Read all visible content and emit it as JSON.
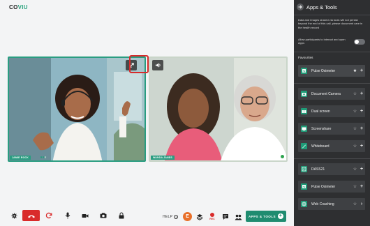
{
  "brand": {
    "part1": "CO",
    "part2": "VIU"
  },
  "participants": [
    {
      "name": "JAMIE ROCK"
    },
    {
      "name": "WANDA JANES"
    }
  ],
  "toolbar": {
    "help_label": "HELP",
    "help_icon": "?",
    "badge_letter": "E",
    "rec_label": "REC",
    "apps_button_label": "APPS & TOOLS",
    "apps_button_icon": "+"
  },
  "panel": {
    "title": "Apps & Tools",
    "note": "Data and images shared via tools will not persist beyond the end of this call, please document care in the health record",
    "allow_label": "Allow participants to interact and open Apps",
    "allow_enabled": false,
    "favourites_title": "Favourites",
    "favourites": [
      {
        "label": "Pulse Oximeter",
        "icon": "pulse-oximeter-icon",
        "starred": true
      }
    ],
    "tools": [
      {
        "label": "Document Camera",
        "icon": "camera-icon"
      },
      {
        "label": "Dual screen",
        "icon": "dual-screen-icon"
      },
      {
        "label": "Screenshare",
        "icon": "screenshare-icon"
      },
      {
        "label": "Whiteboard",
        "icon": "whiteboard-icon"
      }
    ],
    "apps": [
      {
        "label": "DASS21",
        "icon": "form-icon"
      },
      {
        "label": "Pulse Oximeter",
        "icon": "pulse-oximeter-icon"
      },
      {
        "label": "Web Coaching",
        "icon": "web-coaching-icon"
      }
    ]
  },
  "colors": {
    "accent": "#2a9d81",
    "end_call": "#d92b2b",
    "panel_bg": "#2e2f31",
    "badge": "#e8702a"
  }
}
